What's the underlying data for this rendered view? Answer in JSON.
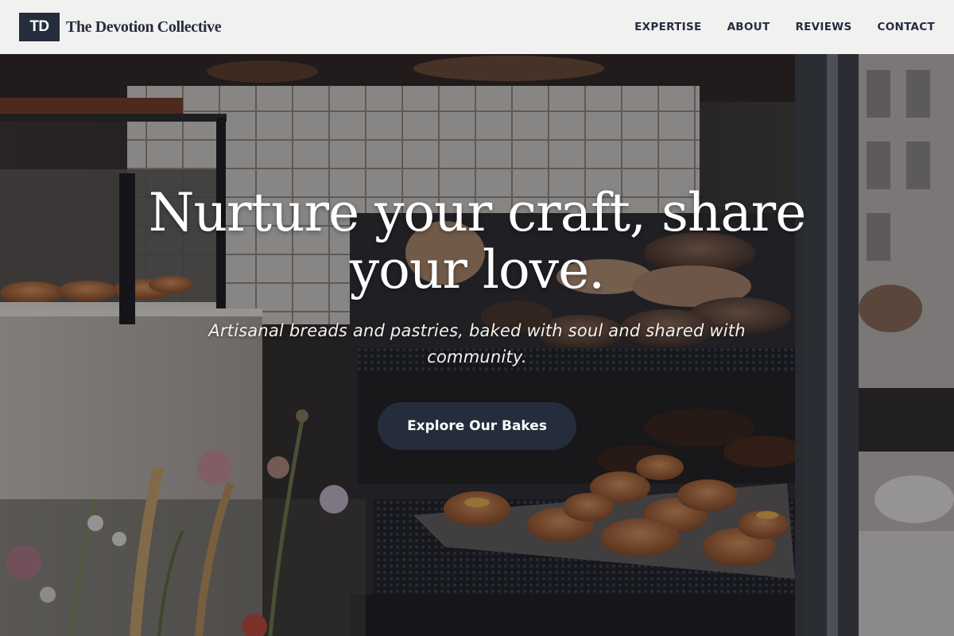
{
  "brand": {
    "logo_text": "TD",
    "name": "The Devotion Collective"
  },
  "nav": {
    "items": [
      {
        "label": "EXPERTISE"
      },
      {
        "label": "ABOUT"
      },
      {
        "label": "REVIEWS"
      },
      {
        "label": "CONTACT"
      }
    ]
  },
  "hero": {
    "title": "Nurture your craft, share your love.",
    "subtitle": "Artisanal breads and pastries, baked with soul and shared with community.",
    "cta_label": "Explore Our Bakes",
    "background_image": "bakery display case with breads, pastries and flowers"
  },
  "colors": {
    "header_bg": "#f1f1f0",
    "brand_navy": "#252c3c",
    "hero_text": "#ffffff"
  }
}
